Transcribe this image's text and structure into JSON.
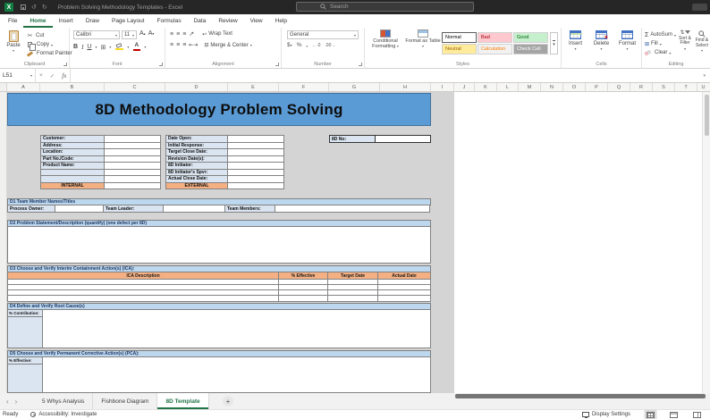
{
  "titlebar": {
    "title": "Problem Solving Methodology Templates - Excel",
    "search_placeholder": "Search"
  },
  "menu": {
    "items": [
      "File",
      "Home",
      "Insert",
      "Draw",
      "Page Layout",
      "Formulas",
      "Data",
      "Review",
      "View",
      "Help"
    ],
    "active": "Home"
  },
  "ribbon": {
    "clipboard": {
      "label": "Clipboard",
      "paste": "Paste",
      "cut": "Cut",
      "copy": "Copy",
      "format_painter": "Format Painter"
    },
    "font": {
      "label": "Font",
      "family": "Calibri",
      "size": "11",
      "bold": "B",
      "italic": "I",
      "underline": "U"
    },
    "alignment": {
      "label": "Alignment",
      "wrap_text": "Wrap Text",
      "merge_center": "Merge & Center"
    },
    "number": {
      "label": "Number",
      "format": "General"
    },
    "styles": {
      "label": "Styles",
      "conditional_formatting": "Conditional Formatting",
      "format_as_table": "Format as Table",
      "gallery": [
        {
          "name": "Normal",
          "bg": "#ffffff",
          "fg": "#000000"
        },
        {
          "name": "Bad",
          "bg": "#ffc7ce",
          "fg": "#9c0006"
        },
        {
          "name": "Good",
          "bg": "#c6efce",
          "fg": "#006100"
        },
        {
          "name": "Neutral",
          "bg": "#ffeb9c",
          "fg": "#9c6500"
        },
        {
          "name": "Calculation",
          "bg": "#f2f2f2",
          "fg": "#fa7d00"
        },
        {
          "name": "Check Cell",
          "bg": "#a5a5a5",
          "fg": "#ffffff"
        }
      ]
    },
    "cells": {
      "label": "Cells",
      "insert": "Insert",
      "delete": "Delete",
      "format": "Format"
    },
    "editing": {
      "label": "Editing",
      "autosum": "AutoSum",
      "fill": "Fill",
      "clear": "Clear",
      "sort_filter": "Sort & Filter",
      "find_select": "Find & Select"
    }
  },
  "formula_bar": {
    "name_box": "L51",
    "fx": "fx"
  },
  "grid": {
    "columns": [
      "A",
      "B",
      "C",
      "D",
      "E",
      "F",
      "G",
      "H",
      "I",
      "J",
      "K",
      "L",
      "M",
      "N",
      "O",
      "P",
      "Q",
      "R",
      "S",
      "T",
      "U"
    ]
  },
  "sheet": {
    "title": "8D Methodology Problem Solving",
    "accent_blue": "#5b9bd5",
    "section_blue": "#bdd7ee",
    "label_blue": "#dbe5f1",
    "accent_orange": "#f4b083",
    "left_labels": [
      "Customer:",
      "Address:",
      "Location:",
      "Part No./Code:",
      "Product Name:"
    ],
    "internal": "INTERNAL",
    "right_labels": [
      "Date Open:",
      "Initial Response:",
      "Target Close Date:",
      "Revision Date(s):",
      "8D Initiator:",
      "8D Initiator's Spvr:",
      "Actual Close Date:"
    ],
    "external": "EXTERNAL",
    "eightd_no": "8D No:",
    "d1_header": "D1 Team Member Names/Titles",
    "process_owner": "Process Owner:",
    "team_leader": "Team Leader:",
    "team_members": "Team Members:",
    "d2_header": "D2 Problem Statement/Description (quantify) (one defect per 8D)",
    "d3_header": "D3 Choose and Verify Interim Containment Action(s) (ICA):",
    "d3_columns": [
      "ICA Description",
      "% Effective",
      "Target Date",
      "Actual Date"
    ],
    "d4_header": "D4 Define and Verify Root Cause(s)",
    "d4_label": "% Contribution:",
    "d5_header": "D5 Choose and Verify Permanent Corrective Action(s) (PCA):",
    "d5_label": "% Effective:"
  },
  "sheet_tabs": {
    "items": [
      "5 Whys Analysis",
      "Fishbone Diagram",
      "8D Template"
    ],
    "active": "8D Template"
  },
  "status_bar": {
    "ready": "Ready",
    "accessibility": "Accessibility: Investigate",
    "display_settings": "Display Settings"
  },
  "colors": {
    "excel_green": "#217346",
    "titlebar_bg": "#262626"
  }
}
